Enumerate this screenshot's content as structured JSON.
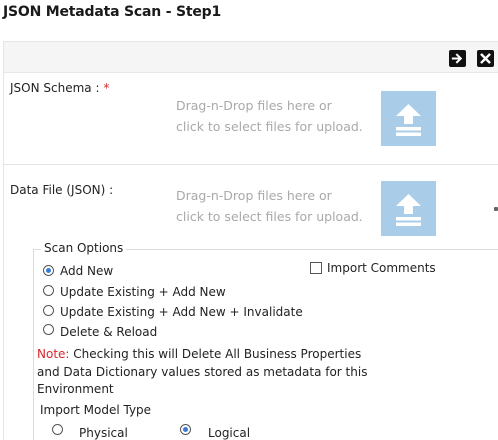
{
  "page": {
    "title": "JSON Metadata Scan - Step1"
  },
  "toolbar": {
    "next_icon": "arrow-right-icon",
    "close_icon": "close-icon"
  },
  "schema": {
    "label": "JSON Schema :",
    "required_mark": "*",
    "drop_line1": "Drag-n-Drop files here or",
    "drop_line2": "click to select files for upload.",
    "icon": "upload-icon"
  },
  "datafile": {
    "label": "Data File (JSON) :",
    "drop_line1": "Drag-n-Drop files here or",
    "drop_line2": "click to select files for upload.",
    "icon": "upload-icon"
  },
  "scan_options": {
    "legend": "Scan Options",
    "options": [
      {
        "label": "Add New",
        "selected": true
      },
      {
        "label": "Update Existing + Add New",
        "selected": false
      },
      {
        "label": "Update Existing + Add New + Invalidate",
        "selected": false
      },
      {
        "label": "Delete & Reload",
        "selected": false
      }
    ],
    "import_comments": {
      "label": "Import Comments",
      "checked": false
    },
    "note_label": "Note:",
    "note_text": " Checking this will Delete All Business Properties and Data Dictionary values stored as metadata for this Environment"
  },
  "import_model": {
    "label": "Import Model Type",
    "options": [
      {
        "label": "Physical",
        "selected": false
      },
      {
        "label": "Logical",
        "selected": true
      }
    ]
  },
  "colors": {
    "accent": "#a9cde8",
    "required": "#d9262c",
    "placeholder": "#a9a9a9"
  }
}
